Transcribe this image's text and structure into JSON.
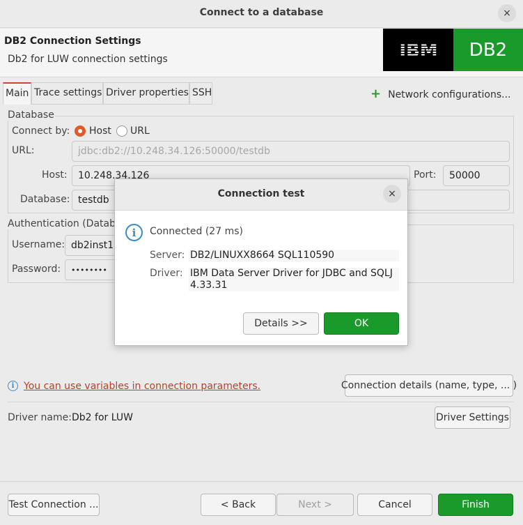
{
  "window": {
    "title": "Connect to a database",
    "close_icon": "×"
  },
  "header": {
    "title": "DB2 Connection Settings",
    "subtitle": "Db2 for LUW connection settings",
    "logo_left": "IBM",
    "logo_right": "DB2",
    "colors": {
      "logo_green": "#1a9a2a",
      "logo_black": "#000000"
    }
  },
  "tabs": [
    {
      "label": "Main",
      "active": true
    },
    {
      "label": "Trace settings",
      "active": false
    },
    {
      "label": "Driver properties",
      "active": false
    },
    {
      "label": "SSH",
      "active": false
    }
  ],
  "network_configurations": {
    "icon": "+",
    "label": "Network configurations..."
  },
  "database_group": {
    "title": "Database",
    "connect_by_label": "Connect by:",
    "option_host": "Host",
    "option_url": "URL",
    "selected": "Host",
    "url_label": "URL:",
    "url_value": "jdbc:db2://10.248.34.126:50000/testdb",
    "host_label": "Host:",
    "host_value": "10.248.34.126",
    "port_label": "Port:",
    "port_value": "50000",
    "database_label": "Database:",
    "database_value": "testdb"
  },
  "auth_group": {
    "title": "Authentication (Databa",
    "username_label": "Username:",
    "username_value": "db2inst1",
    "password_label": "Password:",
    "password_value": "••••••••"
  },
  "variables_hint": {
    "icon": "i",
    "text": "You can use variables in connection parameters."
  },
  "connection_details_button": "Connection details (name, type, ... )",
  "driver": {
    "label": "Driver name:",
    "value": "Db2 for LUW",
    "settings_button": "Driver Settings"
  },
  "footer": {
    "test_connection": "Test Connection ...",
    "back": "< Back",
    "next": "Next >",
    "cancel": "Cancel",
    "finish": "Finish"
  },
  "modal": {
    "title": "Connection test",
    "close_icon": "×",
    "info_icon": "i",
    "status": "Connected (27 ms)",
    "server_label": "Server:",
    "server_value": "DB2/LINUXX8664 SQL110590",
    "driver_label": "Driver:",
    "driver_value_line1": "IBM Data Server Driver for JDBC and SQLJ",
    "driver_value_line2": "4.33.31",
    "details_button": "Details >>",
    "ok_button": "OK"
  }
}
